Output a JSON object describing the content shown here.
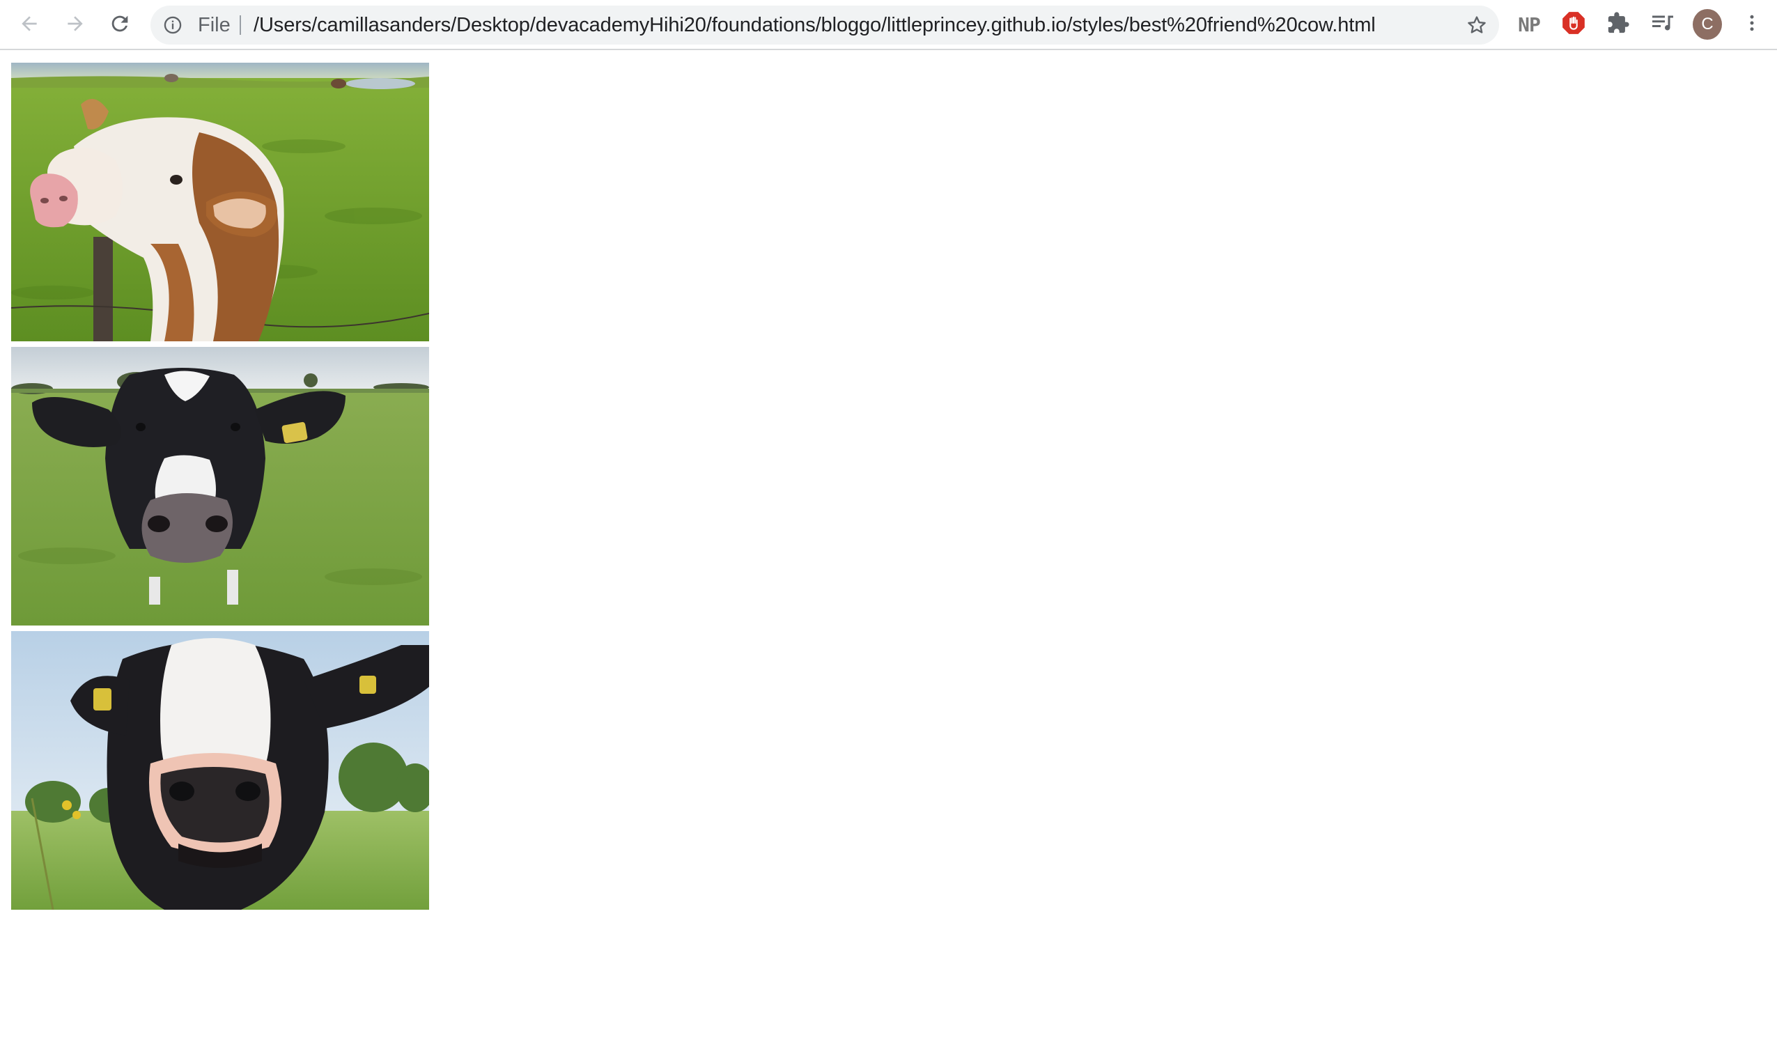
{
  "browser": {
    "omnibox": {
      "scheme_label": "File",
      "url": "/Users/camillasanders/Desktop/devacademyHihi20/foundations/bloggo/littleprincey.github.io/styles/best%20friend%20cow.html"
    },
    "extensions": {
      "np_label": "NP"
    },
    "profile": {
      "initial": "C"
    },
    "icons": [
      "back-arrow-icon",
      "forward-arrow-icon",
      "reload-icon",
      "info-icon",
      "star-icon",
      "stop-hand-icon",
      "puzzle-piece-icon",
      "media-queue-icon",
      "kebab-menu-icon"
    ]
  },
  "page": {
    "images": [
      {
        "subject": "brown-and-white cow leaning over fence"
      },
      {
        "subject": "black-and-white cow with ear tag close-up"
      },
      {
        "subject": "black-and-white cow nose close-up"
      }
    ]
  },
  "colors": {
    "toolbar_bg": "#ffffff",
    "omnibox_bg": "#f1f3f4",
    "icon_gray": "#5f6368",
    "stop_red": "#d93025",
    "avatar_brown": "#8d6e63"
  }
}
